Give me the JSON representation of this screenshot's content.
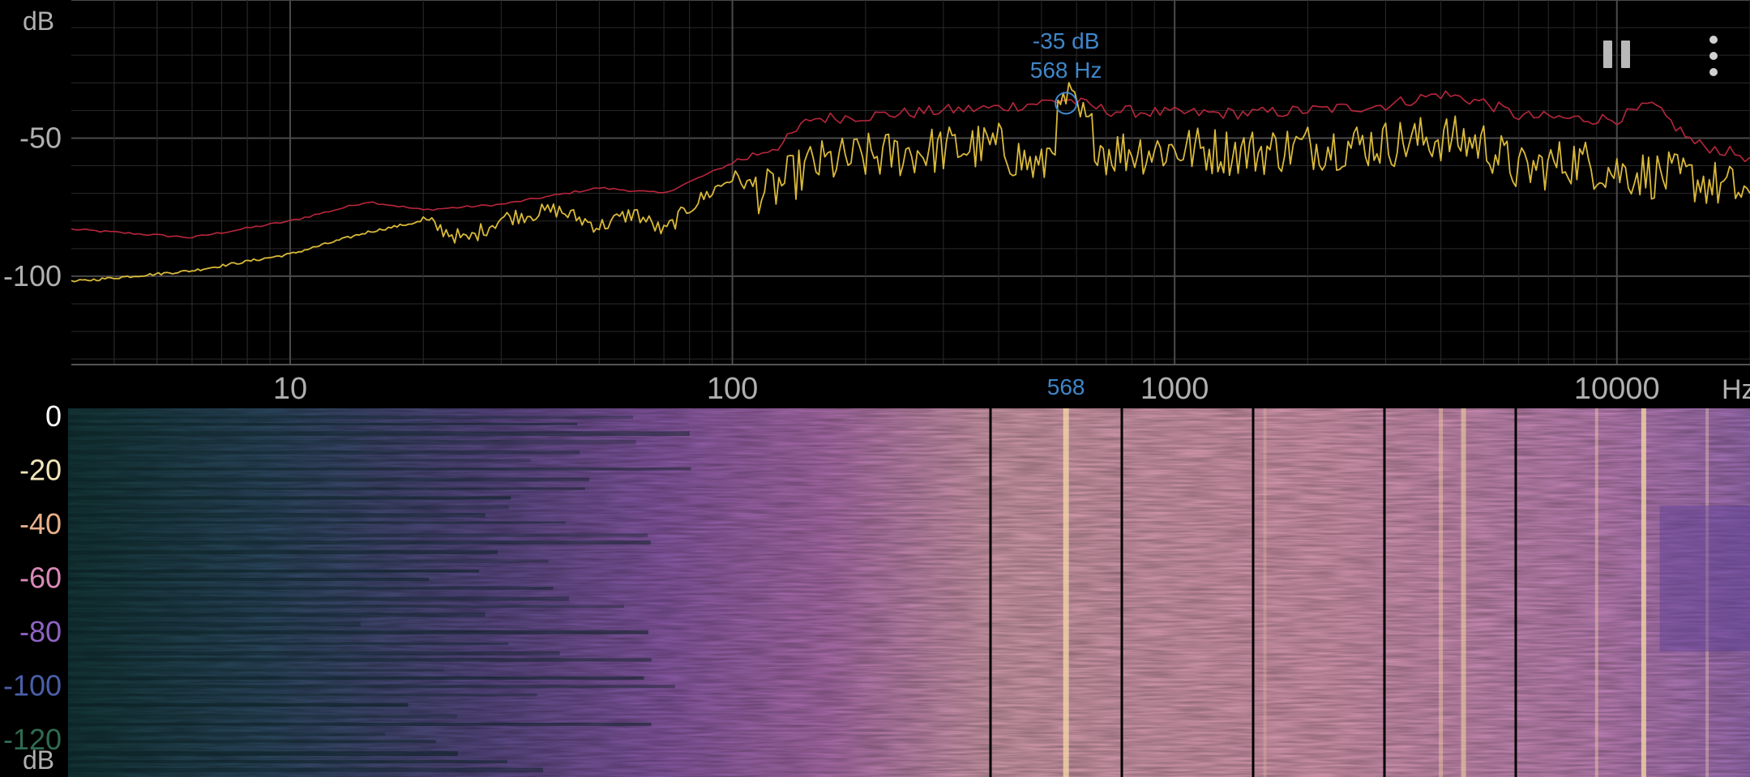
{
  "spectrum": {
    "y_unit": "dB",
    "x_unit": "Hz",
    "y_ticks": [
      {
        "label": "-50",
        "value": -50
      },
      {
        "label": "-100",
        "value": -100
      }
    ],
    "x_ticks": [
      {
        "label": "10",
        "value": 10
      },
      {
        "label": "100",
        "value": 100
      },
      {
        "label": "1000",
        "value": 1000
      },
      {
        "label": "10000",
        "value": 10000
      }
    ],
    "peak": {
      "db_label": "-35 dB",
      "hz_label": "568 Hz",
      "axis_label": "568",
      "freq": 568,
      "db": -35
    },
    "colors": {
      "peak_hold": "#b8263c",
      "live": "#d9b93a",
      "marker": "#3f86c8",
      "grid": "#3a3a3a",
      "tick_text": "#b0b0b0"
    }
  },
  "spectrogram": {
    "y_ticks": [
      {
        "label": "0",
        "value": 0,
        "color": "#ffffff"
      },
      {
        "label": "-20",
        "value": -20,
        "color": "#f2e6b8"
      },
      {
        "label": "-40",
        "value": -40,
        "color": "#e8b08a"
      },
      {
        "label": "-60",
        "value": -60,
        "color": "#d98ab8"
      },
      {
        "label": "-80",
        "value": -80,
        "color": "#8f63c4"
      },
      {
        "label": "-100",
        "value": -100,
        "color": "#4a5fa8"
      },
      {
        "label": "-120",
        "value": -120,
        "color": "#2f6b52"
      }
    ],
    "unit": "dB",
    "colors": {
      "low": "#0f2a28",
      "mid": "#8a5aa8",
      "high": "#f0c8a0"
    }
  },
  "controls": {
    "pause": {
      "icon": "pause-icon"
    },
    "menu": {
      "icon": "more-vertical-icon"
    }
  },
  "chart_data": {
    "type": "line",
    "xlabel": "Hz",
    "ylabel": "dB",
    "xscale": "log",
    "xlim": [
      3.2,
      20000
    ],
    "ylim": [
      -132,
      0
    ],
    "grid": true,
    "series": [
      {
        "color": "#b8263c",
        "x": [
          3.2,
          6,
          10,
          15,
          20,
          30,
          50,
          70,
          100,
          130,
          150,
          200,
          300,
          400,
          568,
          700,
          1000,
          1500,
          2000,
          3000,
          4000,
          5000,
          6000,
          8000,
          10000,
          12000,
          15000,
          20000
        ],
        "values": [
          -83,
          -86,
          -80,
          -73,
          -76,
          -74,
          -68,
          -70,
          -59,
          -52,
          -43,
          -42,
          -40,
          -39,
          -36,
          -40,
          -41,
          -41,
          -40,
          -38,
          -34,
          -37,
          -42,
          -43,
          -43,
          -38,
          -52,
          -57
        ]
      },
      {
        "color": "#d9b93a",
        "x": [
          3.2,
          6,
          10,
          15,
          20,
          25,
          30,
          40,
          50,
          60,
          70,
          80,
          100,
          120,
          150,
          200,
          300,
          400,
          500,
          568,
          700,
          1000,
          1500,
          2000,
          3000,
          4000,
          5000,
          6000,
          8000,
          10000,
          15000,
          20000
        ],
        "values": [
          -102,
          -98,
          -92,
          -84,
          -80,
          -87,
          -79,
          -76,
          -82,
          -77,
          -84,
          -75,
          -64,
          -70,
          -60,
          -57,
          -54,
          -53,
          -62,
          -36,
          -55,
          -54,
          -55,
          -53,
          -52,
          -50,
          -52,
          -62,
          -58,
          -62,
          -65,
          -70
        ]
      }
    ],
    "peak_marker": {
      "x": 568,
      "y": -35
    }
  }
}
